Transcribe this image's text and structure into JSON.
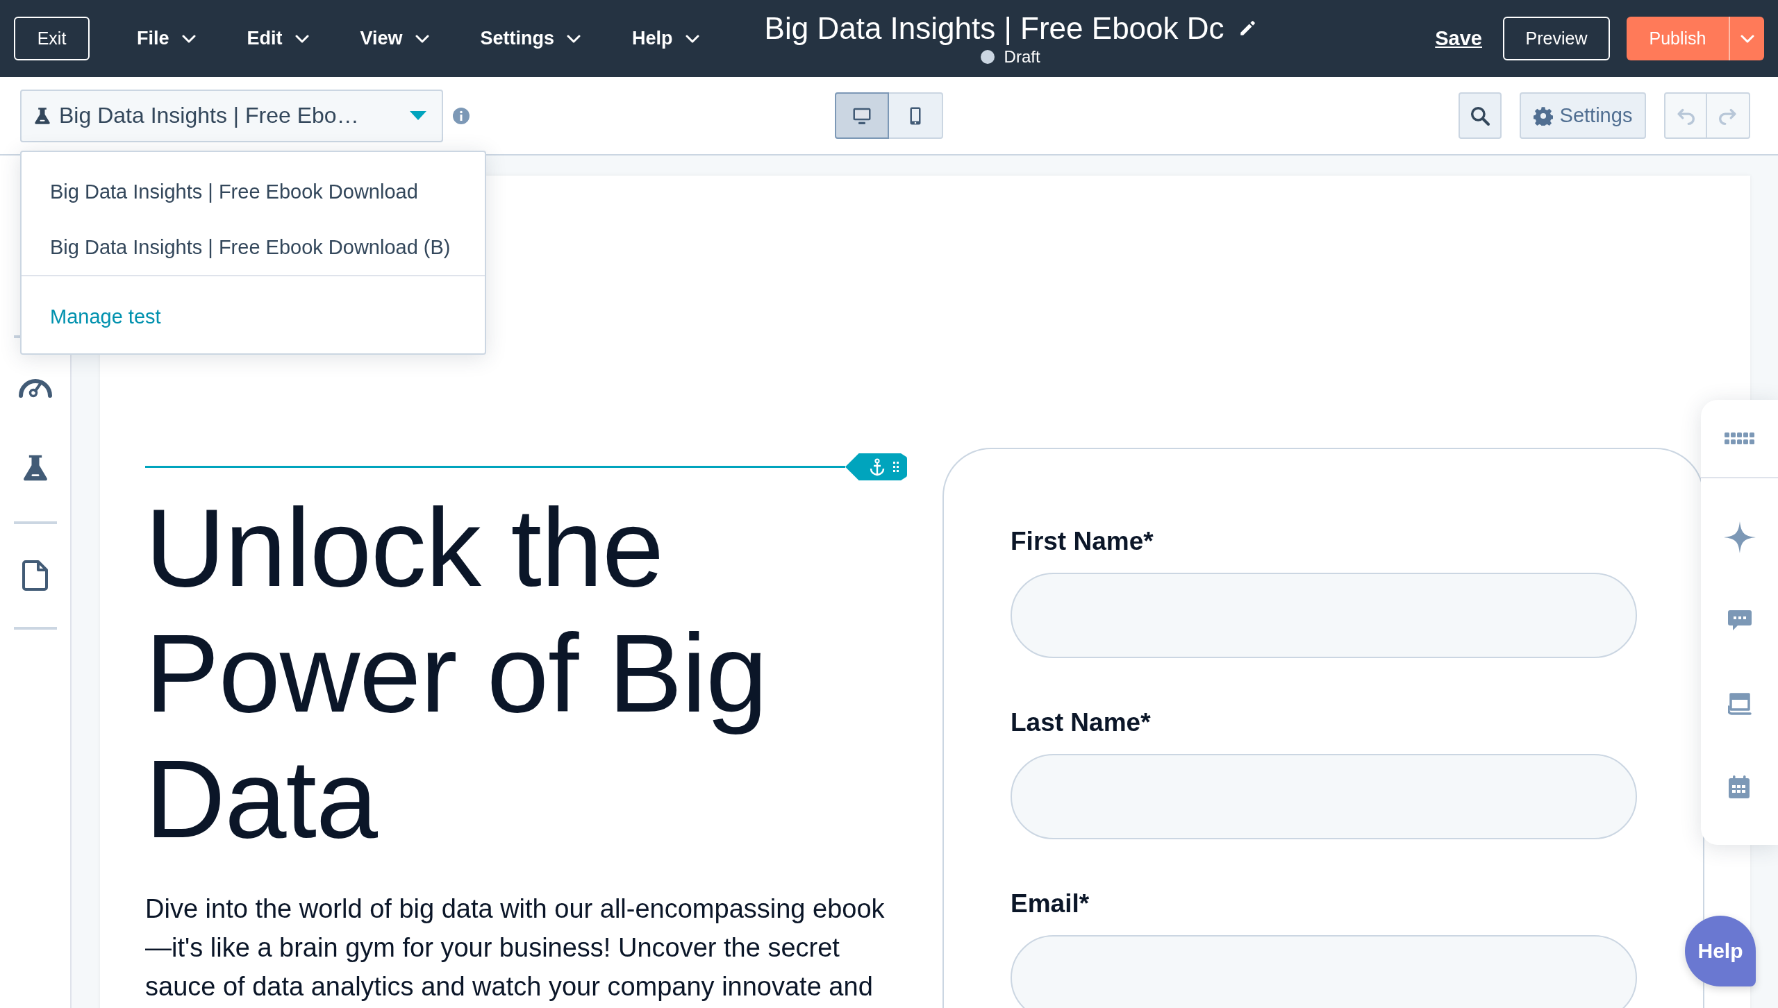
{
  "top_bar": {
    "exit": "Exit",
    "menus": [
      {
        "label": "File"
      },
      {
        "label": "Edit"
      },
      {
        "label": "View"
      },
      {
        "label": "Settings"
      },
      {
        "label": "Help"
      }
    ],
    "title": "Big Data Insights | Free Ebook Dc",
    "status": "Draft",
    "save": "Save",
    "preview": "Preview",
    "publish": "Publish"
  },
  "toolbar": {
    "variant_select": "Big Data Insights | Free Ebo…",
    "view_modes": [
      {
        "kind": "desktop",
        "selected": true
      },
      {
        "kind": "mobile",
        "selected": false
      }
    ],
    "settings": "Settings",
    "history": [
      {
        "kind": "undo",
        "disabled": true
      },
      {
        "kind": "redo",
        "disabled": true
      }
    ]
  },
  "variant_menu": {
    "items": [
      {
        "label": "Big Data Insights | Free Ebook Download"
      },
      {
        "label": "Big Data Insights | Free Ebook Download (B)"
      }
    ],
    "manage": "Manage test"
  },
  "left_rail": [
    {
      "kind": "divider"
    },
    {
      "kind": "gauge"
    },
    {
      "kind": "flask"
    },
    {
      "kind": "divider"
    },
    {
      "kind": "file"
    },
    {
      "kind": "divider"
    }
  ],
  "page": {
    "heading": "Unlock the Power of Big Data",
    "intro": "Dive into the world of big data with our all-encompassing ebook—it's like a brain gym for your business! Uncover the secret sauce of data analytics and watch your company innovate and",
    "form": {
      "fields": [
        {
          "label": "First Name*"
        },
        {
          "label": "Last Name*"
        },
        {
          "label": "Email*"
        }
      ]
    }
  },
  "right_rail": [
    {
      "kind": "grid"
    },
    {
      "kind": "sparkle"
    },
    {
      "kind": "chat"
    },
    {
      "kind": "book"
    },
    {
      "kind": "calendar"
    }
  ],
  "help": "Help"
}
